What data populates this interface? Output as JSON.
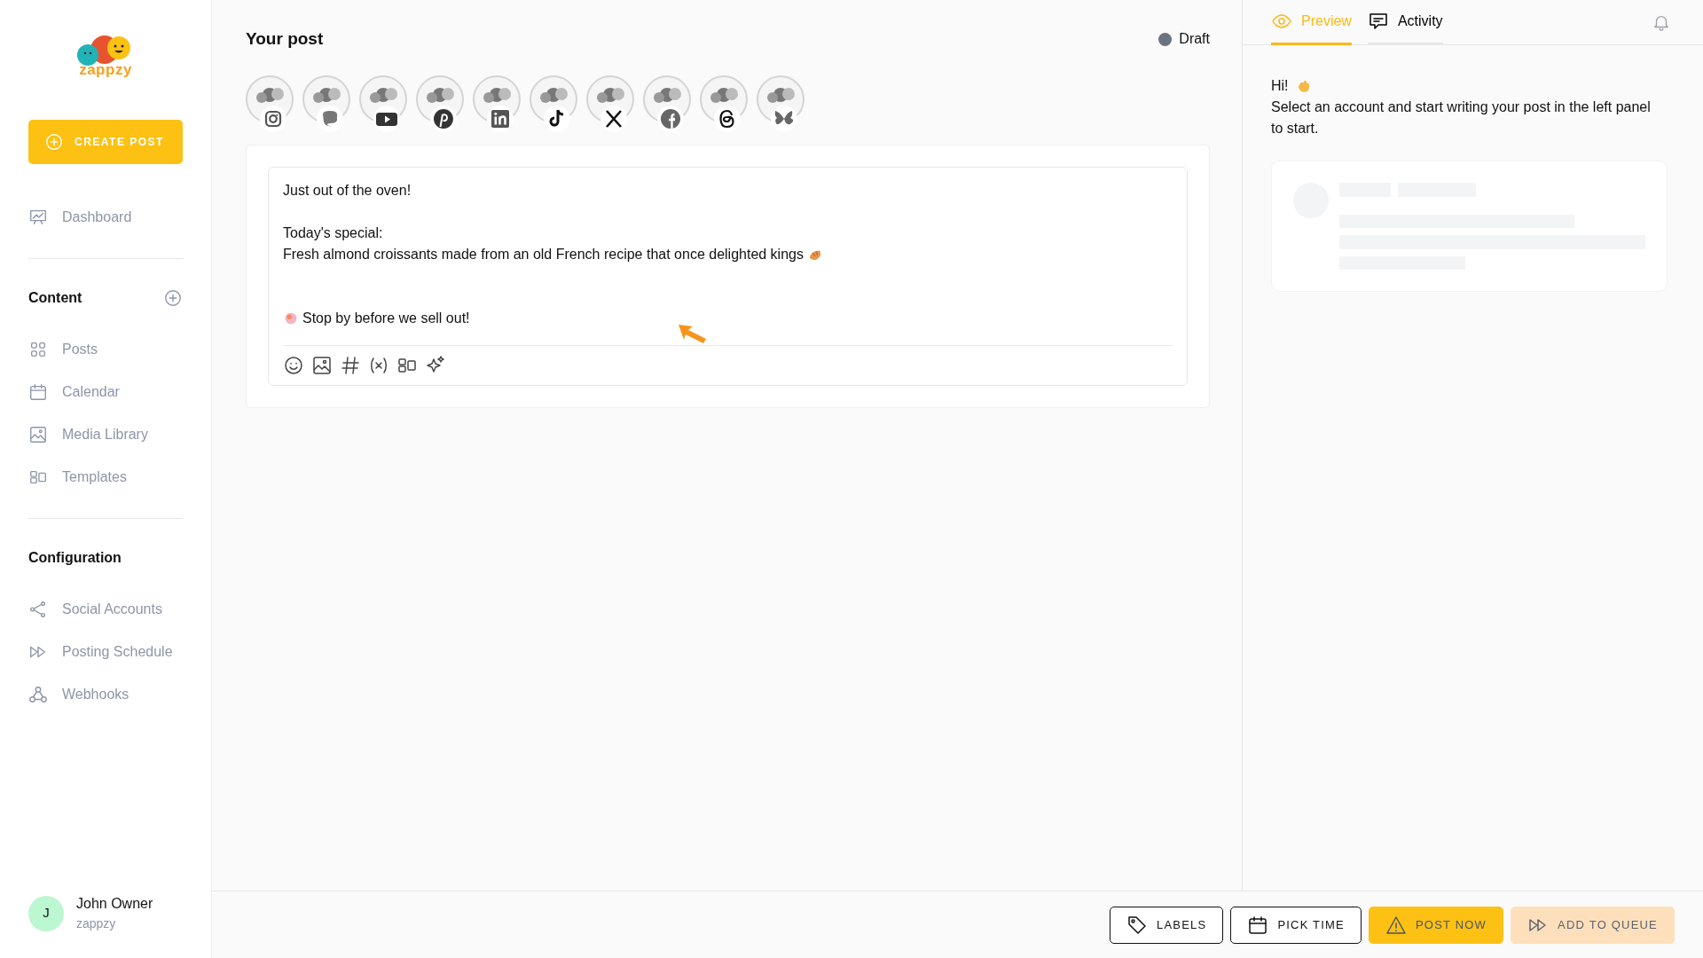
{
  "sidebar": {
    "logo": {
      "text": "zappzy"
    },
    "create_button": {
      "label": "CREATE POST"
    },
    "sections": [
      {
        "items": [
          {
            "label": "Dashboard",
            "selected": false
          }
        ]
      },
      {
        "title": "Content",
        "has_add": true,
        "items": [
          {
            "label": "Posts",
            "selected": false
          },
          {
            "label": "Calendar",
            "selected": false
          },
          {
            "label": "Media Library",
            "selected": false
          },
          {
            "label": "Templates",
            "selected": false
          }
        ]
      },
      {
        "title": "Configuration",
        "has_add": false,
        "items": [
          {
            "label": "Social Accounts",
            "selected": false
          },
          {
            "label": "Posting Schedule",
            "selected": false
          },
          {
            "label": "Webhooks",
            "selected": false
          }
        ]
      }
    ],
    "user": {
      "initial": "J",
      "name": "John Owner",
      "org": "zappzy"
    }
  },
  "post": {
    "title": "Your post",
    "status": {
      "label": "Draft"
    },
    "accounts": [
      {
        "kind": "instagram"
      },
      {
        "kind": "mastodon"
      },
      {
        "kind": "youtube"
      },
      {
        "kind": "pinterest"
      },
      {
        "kind": "linkedin"
      },
      {
        "kind": "tiktok"
      },
      {
        "kind": "x"
      },
      {
        "kind": "facebook"
      },
      {
        "kind": "threads"
      },
      {
        "kind": "bluesky"
      }
    ],
    "editor": {
      "lines": [
        {
          "kind": "text",
          "text": "Just out of the oven!"
        },
        {
          "kind": "blank"
        },
        {
          "kind": "text",
          "text": "Today's special:"
        },
        {
          "kind": "text_emoji_after",
          "text": "Fresh almond croissants made from an old French recipe that once delighted kings"
        },
        {
          "kind": "blank"
        },
        {
          "kind": "blank"
        },
        {
          "kind": "emoji_text",
          "text": "Stop by before we sell out!"
        }
      ]
    }
  },
  "preview": {
    "tabs": [
      {
        "label": "Preview",
        "selected": true
      },
      {
        "label": "Activity",
        "selected": false
      }
    ],
    "greeting": "Hi!",
    "message": "Select an account and start writing your post in the left panel to start."
  },
  "actions": [
    {
      "label": "LABELS",
      "kind": "outline",
      "disabled": false
    },
    {
      "label": "PICK TIME",
      "kind": "outline",
      "disabled": false
    },
    {
      "label": "POST NOW",
      "kind": "primary",
      "disabled": false
    },
    {
      "label": "ADD TO QUEUE",
      "kind": "secondary",
      "disabled": true
    }
  ]
}
